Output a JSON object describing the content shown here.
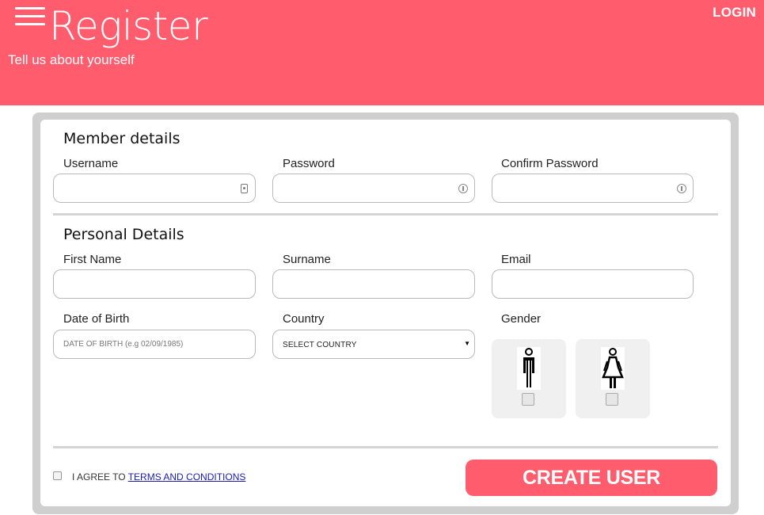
{
  "header": {
    "title": "Register",
    "subtitle": "Tell us about yourself",
    "login_label": "LOGIN"
  },
  "member": {
    "section_title": "Member details",
    "username_label": "Username",
    "password_label": "Password",
    "confirm_password_label": "Confirm Password"
  },
  "personal": {
    "section_title": "Personal Details",
    "first_name_label": "First Name",
    "surname_label": "Surname",
    "email_label": "Email",
    "dob_label": "Date of Birth",
    "dob_placeholder": "DATE OF BIRTH (e.g 02/09/1985)",
    "country_label": "Country",
    "country_selected": "SELECT COUNTRY",
    "gender_label": "Gender"
  },
  "footer": {
    "agree_prefix": "I AGREE TO ",
    "terms_link": "TERMS AND CONDITIONS",
    "create_button": "CREATE USER"
  },
  "colors": {
    "accent": "#ff5c6e",
    "frame": "#cfcfcf"
  },
  "icons": {
    "menu": "hamburger-icon",
    "username_field": "contact-card-icon",
    "password_field": "key-icon",
    "male": "male-figure-icon",
    "female": "female-figure-icon"
  }
}
